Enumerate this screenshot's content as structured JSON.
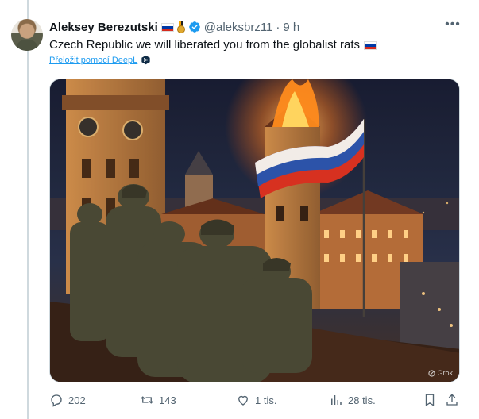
{
  "tweet": {
    "author_name": "Aleksey Berezutski",
    "handle": "@aleksbrz11",
    "separator": "·",
    "time": "9 h",
    "text": "Czech Republic we will liberated you from the globalist rats",
    "translate_link": "Přeložit pomocí DeepL",
    "media_watermark": "Grok"
  },
  "icons": {
    "author_flag": "russian-flag-icon",
    "author_medal": "medal-icon",
    "verified": "verified-badge-icon",
    "more": "more-options-icon",
    "text_flag": "russian-flag-icon",
    "deepl": "deepl-icon"
  },
  "actions": {
    "replies": "202",
    "reposts": "143",
    "likes": "1 tis.",
    "views": "28 tis."
  },
  "colors": {
    "accent": "#1d9bf0",
    "muted": "#536471",
    "thread_line": "#cfd9de"
  }
}
